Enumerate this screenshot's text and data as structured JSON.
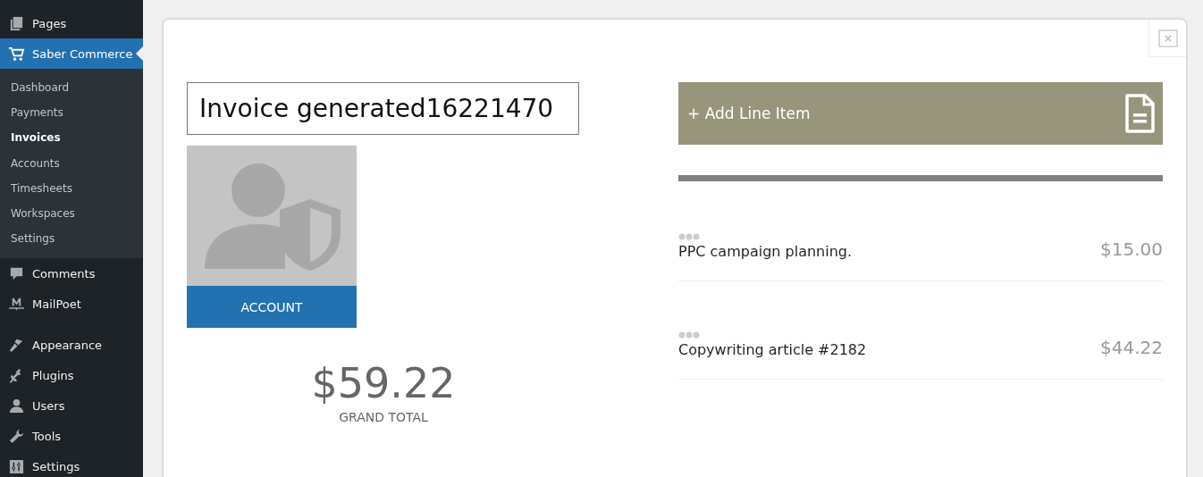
{
  "sidebar": {
    "items": [
      {
        "label": "Pages",
        "kind": "pages",
        "selected": false
      },
      {
        "label": "Saber Commerce",
        "kind": "cart",
        "selected": true,
        "children": [
          {
            "label": "Dashboard",
            "selected": false
          },
          {
            "label": "Payments",
            "selected": false
          },
          {
            "label": "Invoices",
            "selected": true
          },
          {
            "label": "Accounts",
            "selected": false
          },
          {
            "label": "Timesheets",
            "selected": false
          },
          {
            "label": "Workspaces",
            "selected": false
          },
          {
            "label": "Settings",
            "selected": false
          }
        ]
      },
      {
        "label": "Comments",
        "kind": "comment",
        "selected": false
      },
      {
        "label": "MailPoet",
        "kind": "mailpoet",
        "selected": false
      },
      {
        "label": "Appearance",
        "kind": "brush",
        "selected": false
      },
      {
        "label": "Plugins",
        "kind": "plug",
        "selected": false
      },
      {
        "label": "Users",
        "kind": "user",
        "selected": false
      },
      {
        "label": "Tools",
        "kind": "wrench",
        "selected": false
      },
      {
        "label": "Settings",
        "kind": "sliders",
        "selected": false
      }
    ]
  },
  "invoice": {
    "title": "Invoice generated16221470",
    "account_button": "ACCOUNT",
    "grand_total": "$59.22",
    "grand_total_label": "GRAND TOTAL",
    "add_line_item": "+ Add Line Item",
    "line_items": [
      {
        "title": "PPC campaign planning.",
        "amount": "$15.00"
      },
      {
        "title": "Copywriting article #2182",
        "amount": "$44.22"
      }
    ]
  }
}
